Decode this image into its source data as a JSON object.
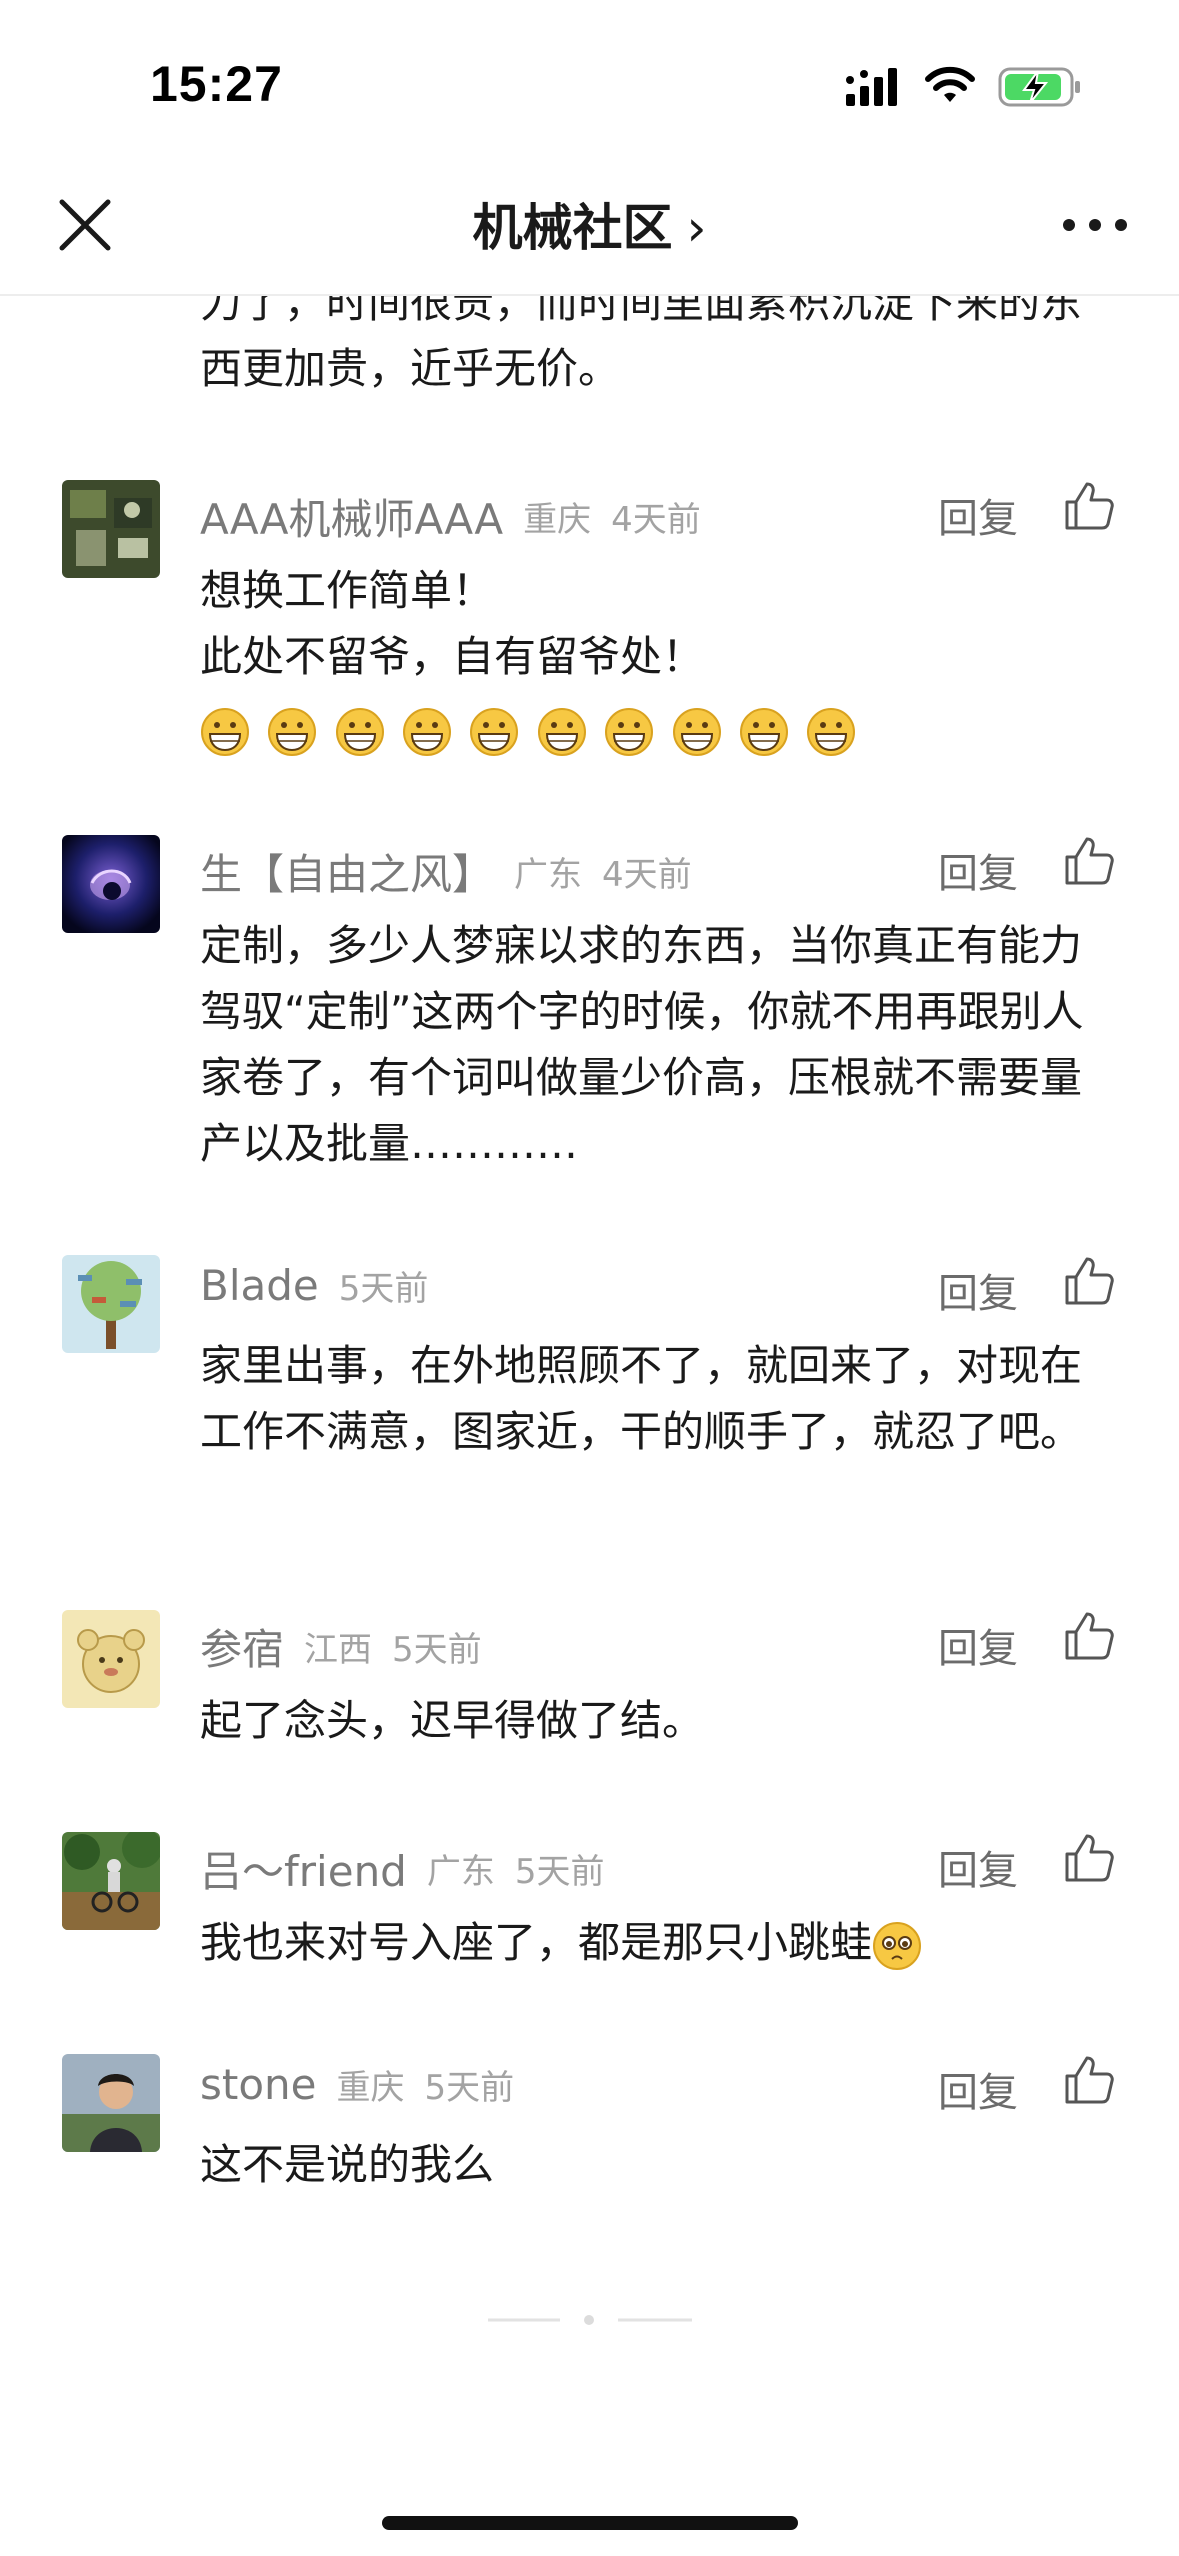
{
  "status_bar": {
    "time": "15:27"
  },
  "nav": {
    "title": "机械社区",
    "chevron": "›"
  },
  "previous_comment": {
    "text": "力了，时间很贵，而时间里面累积沉淀下来的东西更加贵，近乎无价。"
  },
  "comments": [
    {
      "username": "AAA机械师AAA",
      "location": "重庆",
      "time": "4天前",
      "reply": "回复",
      "lines": [
        "想换工作简单！",
        "此处不留爷，自有留爷处！"
      ],
      "emoji": "grinning-face-emoji",
      "emoji_count": 10
    },
    {
      "username": "生【自由之风】",
      "location": "广东",
      "time": "4天前",
      "reply": "回复",
      "text": "定制，多少人梦寐以求的东西，当你真正有能力驾驭“定制”这两个字的时候，你就不用再跟别人家卷了，有个词叫做量少价高，压根就不需要量产以及批量…………"
    },
    {
      "username": "Blade",
      "location": "",
      "time": "5天前",
      "reply": "回复",
      "text": "家里出事，在外地照顾不了，就回来了，对现在工作不满意，图家近，干的顺手了，就忍了吧。"
    },
    {
      "username": "参宿",
      "location": "江西",
      "time": "5天前",
      "reply": "回复",
      "text": "起了念头，迟早得做了结。"
    },
    {
      "username": "吕～friend",
      "location": "广东",
      "time": "5天前",
      "reply": "回复",
      "text": "我也来对号入座了，都是那只小跳蛙",
      "emoji": "pleading-face-emoji"
    },
    {
      "username": "stone",
      "location": "重庆",
      "time": "5天前",
      "reply": "回复",
      "text": "这不是说的我么"
    }
  ],
  "colors": {
    "accent_text": "#1a1a1a",
    "meta_gray": "#a3a3a3",
    "battery_green": "#4cd964"
  }
}
